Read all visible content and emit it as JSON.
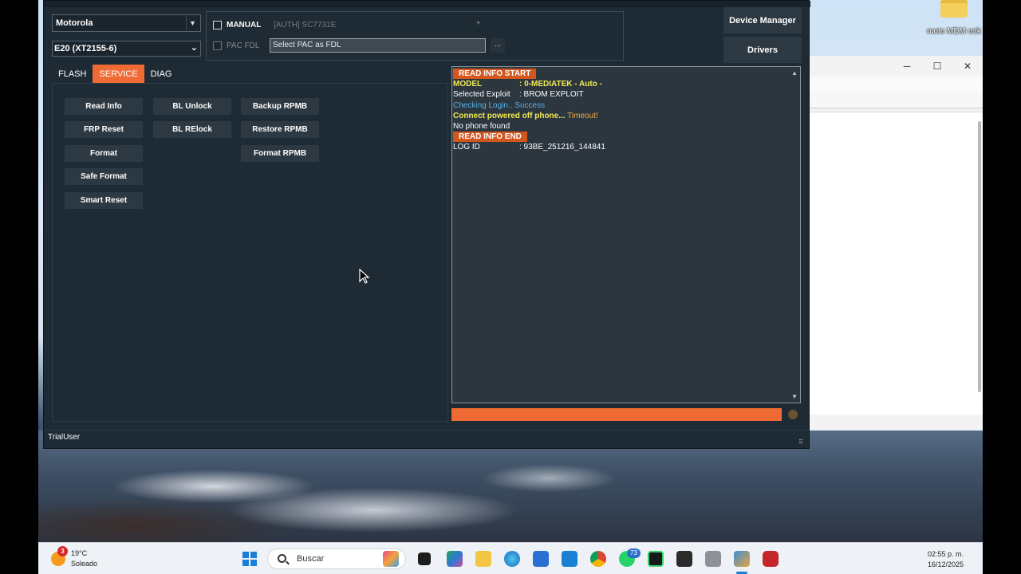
{
  "desktop": {
    "icon_label": "moto MDM mtk"
  },
  "bg_window": {
    "minimize": "─",
    "maximize": "☐",
    "close": "✕"
  },
  "app": {
    "brand_select": "Motorola",
    "model_select": "E20 (XT2155-6)",
    "manual_label": "MANUAL",
    "auth_select": "[AUTH] SC7731E",
    "pac_fdl_label": "PAC FDL",
    "pac_input_value": "Select PAC as FDL",
    "pac_browse": "...",
    "device_manager": "Device Manager",
    "drivers": "Drivers",
    "tabs": [
      "FLASH",
      "SERVICE",
      "DIAG"
    ],
    "active_tab": "SERVICE",
    "buttons": {
      "read_info": "Read Info",
      "frp_reset": "FRP Reset",
      "format": "Format",
      "safe_format": "Safe Format",
      "smart_reset": "Smart Reset",
      "bl_unlock": "BL Unlock",
      "bl_relock": "BL RElock",
      "backup_rpmb": "Backup RPMB",
      "restore_rpmb": "Restore RPMB",
      "format_rpmb": "Format RPMB"
    },
    "log": {
      "start_badge": "READ INFO START",
      "model_key": "MODEL",
      "model_value": ": 0-MEDIATEK - Auto -",
      "exploit_key": "Selected Exploit",
      "exploit_value": ": BROM EXPLOIT",
      "login": "Checking Login.. Success",
      "connect": "Connect powered off phone...",
      "timeout": "Timeout!",
      "no_phone": "No phone found",
      "end_badge": "READ INFO END",
      "logid_key": "LOG ID",
      "logid_value": ": 93BE_251216_144841"
    },
    "progress_fraction": 1.0,
    "status_user": "TrialUser"
  },
  "taskbar": {
    "temperature": "19°C",
    "weather": "Soleado",
    "weather_badge": "3",
    "search_placeholder": "Buscar",
    "whatsapp_badge": "73",
    "time": "02:55 p. m.",
    "date": "16/12/2025"
  },
  "colors": {
    "accent": "#f06a34",
    "log_badge": "#d4561f",
    "log_yellow": "#f2ea52",
    "log_blue": "#5aaee6"
  }
}
